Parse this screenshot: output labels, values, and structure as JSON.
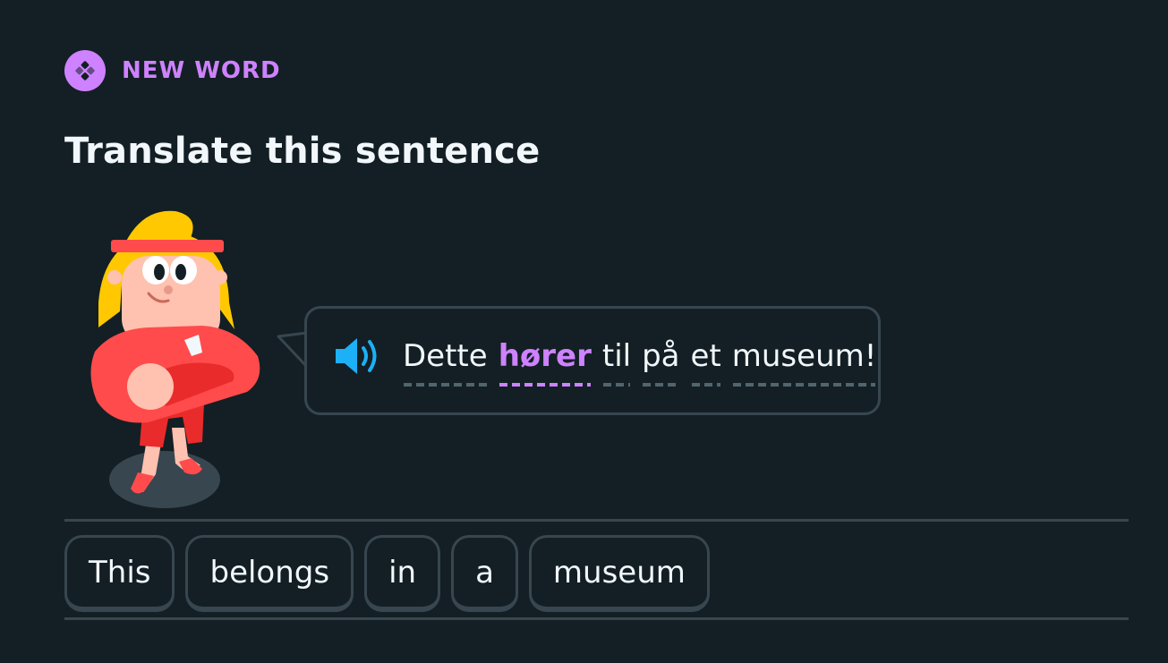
{
  "header": {
    "badge_icon": "new-word-diamond-icon",
    "badge_label": "NEW WORD",
    "title": "Translate this sentence"
  },
  "prompt": {
    "speaker_icon": "speaker-icon",
    "tokens": [
      {
        "text": "Dette",
        "highlight": false
      },
      {
        "text": "hører",
        "highlight": true
      },
      {
        "text": "til",
        "highlight": false
      },
      {
        "text": "på",
        "highlight": false
      },
      {
        "text": "et",
        "highlight": false
      },
      {
        "text": "museum!",
        "highlight": false
      }
    ]
  },
  "answer": {
    "chips": [
      "This",
      "belongs",
      "in",
      "a",
      "museum"
    ]
  },
  "colors": {
    "background": "#131f24",
    "accent_purple": "#ce82ff",
    "border": "#37464f",
    "speaker_blue": "#1cb0f6",
    "text": "#f1f7fb"
  }
}
